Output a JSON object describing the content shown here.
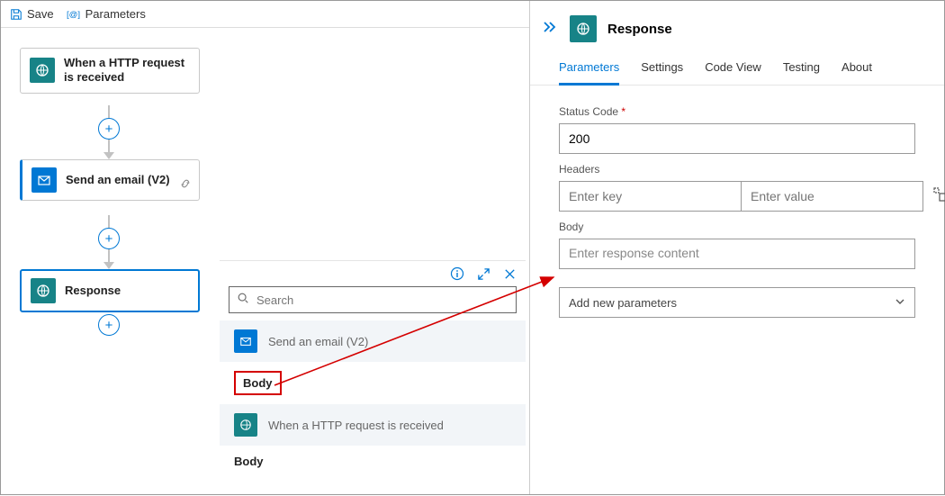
{
  "toolbar": {
    "save": "Save",
    "parameters": "Parameters"
  },
  "nodes": {
    "http": "When a HTTP request is received",
    "email": "Send an email (V2)",
    "response": "Response"
  },
  "popup": {
    "search_placeholder": "Search",
    "item_email": "Send an email (V2)",
    "sub_body": "Body",
    "item_http": "When a HTTP request is received",
    "sub_body2": "Body"
  },
  "panel": {
    "title": "Response",
    "tabs": {
      "parameters": "Parameters",
      "settings": "Settings",
      "codeview": "Code View",
      "testing": "Testing",
      "about": "About"
    },
    "status_label": "Status Code",
    "status_value": "200",
    "headers_label": "Headers",
    "headers_key_ph": "Enter key",
    "headers_val_ph": "Enter value",
    "body_label": "Body",
    "body_ph": "Enter response content",
    "dropdown": "Add new parameters"
  }
}
